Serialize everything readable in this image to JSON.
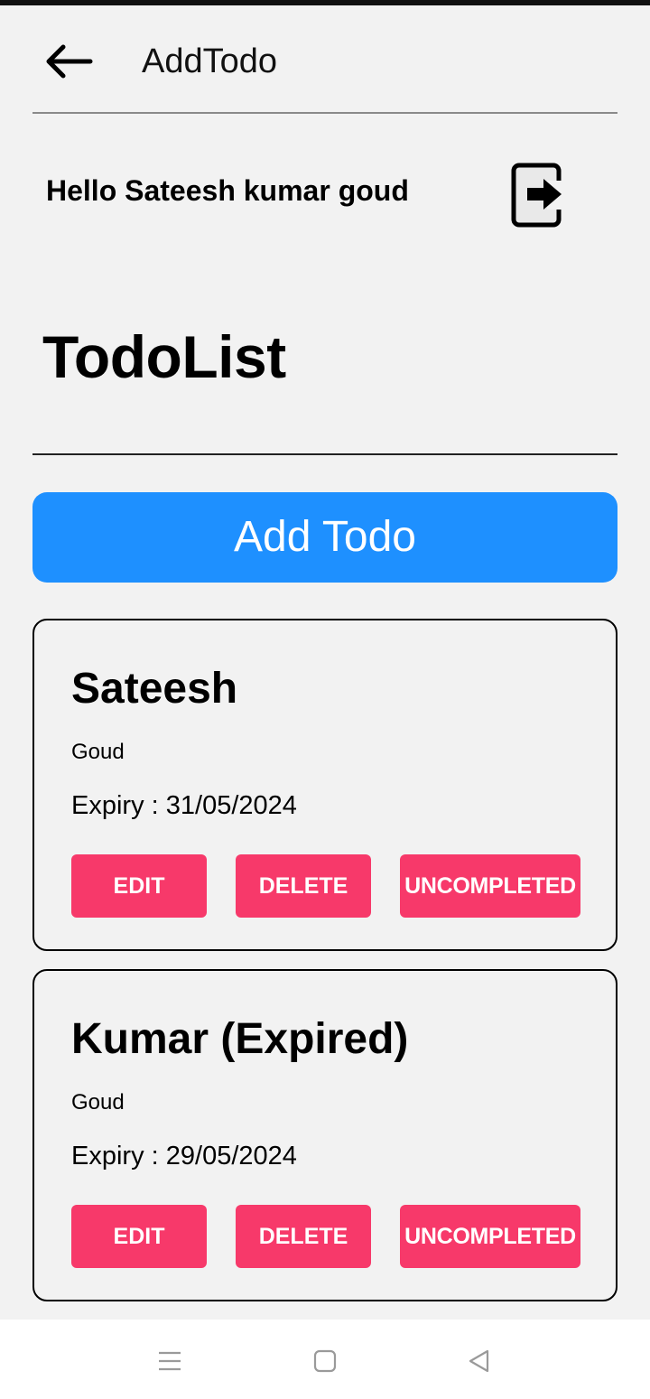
{
  "header": {
    "title": "AddTodo",
    "back_icon": "arrow-left-icon"
  },
  "greeting": {
    "text": "Hello Sateesh kumar goud",
    "logout_icon": "logout-icon"
  },
  "list": {
    "title": "TodoList"
  },
  "add_button": {
    "label": "Add Todo",
    "color": "#1e90ff"
  },
  "todos": [
    {
      "title": "Sateesh",
      "description": "Goud",
      "expiry_label": "Expiry : ",
      "expiry_date": "31/05/2024",
      "edit_label": "EDIT",
      "delete_label": "DELETE",
      "status_label": "UNCOMPLETED"
    },
    {
      "title": "Kumar (Expired)",
      "description": "Goud",
      "expiry_label": "Expiry : ",
      "expiry_date": "29/05/2024",
      "edit_label": "EDIT",
      "delete_label": "DELETE",
      "status_label": "UNCOMPLETED"
    }
  ],
  "colors": {
    "action_button": "#f7396a",
    "background": "#f2f2f2"
  },
  "navbar": {
    "icons": [
      "menu-icon",
      "home-square-icon",
      "back-triangle-icon"
    ]
  }
}
